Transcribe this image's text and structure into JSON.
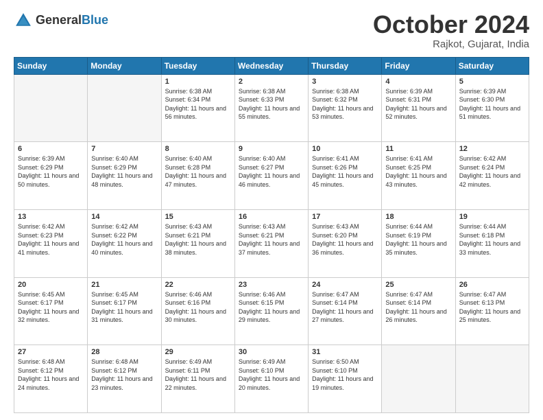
{
  "header": {
    "logo_general": "General",
    "logo_blue": "Blue",
    "month_title": "October 2024",
    "location": "Rajkot, Gujarat, India"
  },
  "weekdays": [
    "Sunday",
    "Monday",
    "Tuesday",
    "Wednesday",
    "Thursday",
    "Friday",
    "Saturday"
  ],
  "weeks": [
    [
      {
        "day": "",
        "empty": true
      },
      {
        "day": "",
        "empty": true
      },
      {
        "day": "1",
        "sunrise": "Sunrise: 6:38 AM",
        "sunset": "Sunset: 6:34 PM",
        "daylight": "Daylight: 11 hours and 56 minutes."
      },
      {
        "day": "2",
        "sunrise": "Sunrise: 6:38 AM",
        "sunset": "Sunset: 6:33 PM",
        "daylight": "Daylight: 11 hours and 55 minutes."
      },
      {
        "day": "3",
        "sunrise": "Sunrise: 6:38 AM",
        "sunset": "Sunset: 6:32 PM",
        "daylight": "Daylight: 11 hours and 53 minutes."
      },
      {
        "day": "4",
        "sunrise": "Sunrise: 6:39 AM",
        "sunset": "Sunset: 6:31 PM",
        "daylight": "Daylight: 11 hours and 52 minutes."
      },
      {
        "day": "5",
        "sunrise": "Sunrise: 6:39 AM",
        "sunset": "Sunset: 6:30 PM",
        "daylight": "Daylight: 11 hours and 51 minutes."
      }
    ],
    [
      {
        "day": "6",
        "sunrise": "Sunrise: 6:39 AM",
        "sunset": "Sunset: 6:29 PM",
        "daylight": "Daylight: 11 hours and 50 minutes."
      },
      {
        "day": "7",
        "sunrise": "Sunrise: 6:40 AM",
        "sunset": "Sunset: 6:29 PM",
        "daylight": "Daylight: 11 hours and 48 minutes."
      },
      {
        "day": "8",
        "sunrise": "Sunrise: 6:40 AM",
        "sunset": "Sunset: 6:28 PM",
        "daylight": "Daylight: 11 hours and 47 minutes."
      },
      {
        "day": "9",
        "sunrise": "Sunrise: 6:40 AM",
        "sunset": "Sunset: 6:27 PM",
        "daylight": "Daylight: 11 hours and 46 minutes."
      },
      {
        "day": "10",
        "sunrise": "Sunrise: 6:41 AM",
        "sunset": "Sunset: 6:26 PM",
        "daylight": "Daylight: 11 hours and 45 minutes."
      },
      {
        "day": "11",
        "sunrise": "Sunrise: 6:41 AM",
        "sunset": "Sunset: 6:25 PM",
        "daylight": "Daylight: 11 hours and 43 minutes."
      },
      {
        "day": "12",
        "sunrise": "Sunrise: 6:42 AM",
        "sunset": "Sunset: 6:24 PM",
        "daylight": "Daylight: 11 hours and 42 minutes."
      }
    ],
    [
      {
        "day": "13",
        "sunrise": "Sunrise: 6:42 AM",
        "sunset": "Sunset: 6:23 PM",
        "daylight": "Daylight: 11 hours and 41 minutes."
      },
      {
        "day": "14",
        "sunrise": "Sunrise: 6:42 AM",
        "sunset": "Sunset: 6:22 PM",
        "daylight": "Daylight: 11 hours and 40 minutes."
      },
      {
        "day": "15",
        "sunrise": "Sunrise: 6:43 AM",
        "sunset": "Sunset: 6:21 PM",
        "daylight": "Daylight: 11 hours and 38 minutes."
      },
      {
        "day": "16",
        "sunrise": "Sunrise: 6:43 AM",
        "sunset": "Sunset: 6:21 PM",
        "daylight": "Daylight: 11 hours and 37 minutes."
      },
      {
        "day": "17",
        "sunrise": "Sunrise: 6:43 AM",
        "sunset": "Sunset: 6:20 PM",
        "daylight": "Daylight: 11 hours and 36 minutes."
      },
      {
        "day": "18",
        "sunrise": "Sunrise: 6:44 AM",
        "sunset": "Sunset: 6:19 PM",
        "daylight": "Daylight: 11 hours and 35 minutes."
      },
      {
        "day": "19",
        "sunrise": "Sunrise: 6:44 AM",
        "sunset": "Sunset: 6:18 PM",
        "daylight": "Daylight: 11 hours and 33 minutes."
      }
    ],
    [
      {
        "day": "20",
        "sunrise": "Sunrise: 6:45 AM",
        "sunset": "Sunset: 6:17 PM",
        "daylight": "Daylight: 11 hours and 32 minutes."
      },
      {
        "day": "21",
        "sunrise": "Sunrise: 6:45 AM",
        "sunset": "Sunset: 6:17 PM",
        "daylight": "Daylight: 11 hours and 31 minutes."
      },
      {
        "day": "22",
        "sunrise": "Sunrise: 6:46 AM",
        "sunset": "Sunset: 6:16 PM",
        "daylight": "Daylight: 11 hours and 30 minutes."
      },
      {
        "day": "23",
        "sunrise": "Sunrise: 6:46 AM",
        "sunset": "Sunset: 6:15 PM",
        "daylight": "Daylight: 11 hours and 29 minutes."
      },
      {
        "day": "24",
        "sunrise": "Sunrise: 6:47 AM",
        "sunset": "Sunset: 6:14 PM",
        "daylight": "Daylight: 11 hours and 27 minutes."
      },
      {
        "day": "25",
        "sunrise": "Sunrise: 6:47 AM",
        "sunset": "Sunset: 6:14 PM",
        "daylight": "Daylight: 11 hours and 26 minutes."
      },
      {
        "day": "26",
        "sunrise": "Sunrise: 6:47 AM",
        "sunset": "Sunset: 6:13 PM",
        "daylight": "Daylight: 11 hours and 25 minutes."
      }
    ],
    [
      {
        "day": "27",
        "sunrise": "Sunrise: 6:48 AM",
        "sunset": "Sunset: 6:12 PM",
        "daylight": "Daylight: 11 hours and 24 minutes."
      },
      {
        "day": "28",
        "sunrise": "Sunrise: 6:48 AM",
        "sunset": "Sunset: 6:12 PM",
        "daylight": "Daylight: 11 hours and 23 minutes."
      },
      {
        "day": "29",
        "sunrise": "Sunrise: 6:49 AM",
        "sunset": "Sunset: 6:11 PM",
        "daylight": "Daylight: 11 hours and 22 minutes."
      },
      {
        "day": "30",
        "sunrise": "Sunrise: 6:49 AM",
        "sunset": "Sunset: 6:10 PM",
        "daylight": "Daylight: 11 hours and 20 minutes."
      },
      {
        "day": "31",
        "sunrise": "Sunrise: 6:50 AM",
        "sunset": "Sunset: 6:10 PM",
        "daylight": "Daylight: 11 hours and 19 minutes."
      },
      {
        "day": "",
        "empty": true
      },
      {
        "day": "",
        "empty": true
      }
    ]
  ]
}
